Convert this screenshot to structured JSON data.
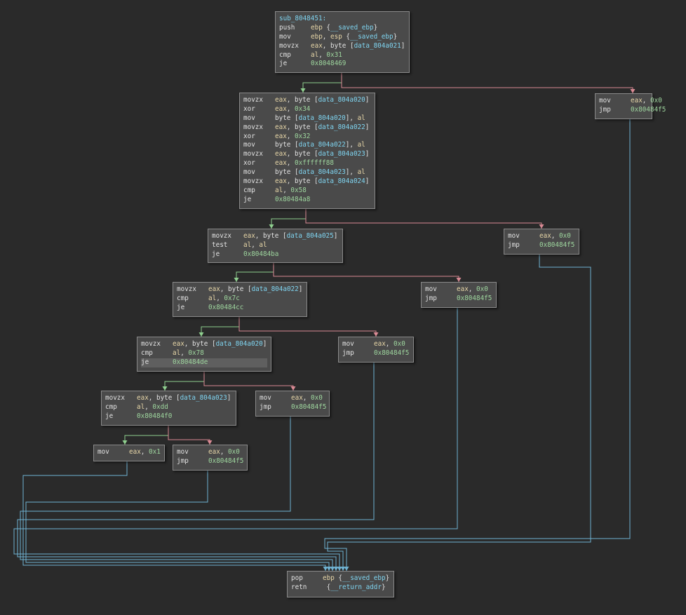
{
  "colors": {
    "background": "#2a2a2a",
    "block_fill": "#4a4a4a",
    "block_border": "#8a8a8a",
    "edge_true": "#8fcf8f",
    "edge_false": "#d98a94",
    "edge_jump": "#6fb2d2",
    "register": "#e8d7a8",
    "data_ref": "#7fd4f0",
    "number": "#9ed69e"
  },
  "blocks": {
    "entry": {
      "label": "sub_8048451:",
      "lines": [
        {
          "m": "push",
          "ops": [
            {
              "t": "reg",
              "v": "ebp"
            },
            {
              "t": "txt",
              "v": " {"
            },
            {
              "t": "dat",
              "v": "__saved_ebp"
            },
            {
              "t": "txt",
              "v": "}"
            }
          ]
        },
        {
          "m": "mov",
          "ops": [
            {
              "t": "reg",
              "v": "ebp"
            },
            {
              "t": "txt",
              "v": ", "
            },
            {
              "t": "reg",
              "v": "esp"
            },
            {
              "t": "txt",
              "v": " {"
            },
            {
              "t": "dat",
              "v": "__saved_ebp"
            },
            {
              "t": "txt",
              "v": "}"
            }
          ]
        },
        {
          "m": "movzx",
          "ops": [
            {
              "t": "reg",
              "v": "eax"
            },
            {
              "t": "txt",
              "v": ", byte ["
            },
            {
              "t": "dat",
              "v": "data_804a021"
            },
            {
              "t": "txt",
              "v": "]"
            }
          ]
        },
        {
          "m": "cmp",
          "ops": [
            {
              "t": "reg",
              "v": "al"
            },
            {
              "t": "txt",
              "v": ", "
            },
            {
              "t": "hex",
              "v": "0x31"
            }
          ]
        },
        {
          "m": "je",
          "ops": [
            {
              "t": "hex",
              "v": "0x8048469"
            }
          ]
        }
      ]
    },
    "b1": {
      "lines": [
        {
          "m": "movzx",
          "ops": [
            {
              "t": "reg",
              "v": "eax"
            },
            {
              "t": "txt",
              "v": ", byte ["
            },
            {
              "t": "dat",
              "v": "data_804a020"
            },
            {
              "t": "txt",
              "v": "]"
            }
          ]
        },
        {
          "m": "xor",
          "ops": [
            {
              "t": "reg",
              "v": "eax"
            },
            {
              "t": "txt",
              "v": ", "
            },
            {
              "t": "hex",
              "v": "0x34"
            }
          ]
        },
        {
          "m": "mov",
          "ops": [
            {
              "t": "txt",
              "v": "byte ["
            },
            {
              "t": "dat",
              "v": "data_804a020"
            },
            {
              "t": "txt",
              "v": "], "
            },
            {
              "t": "reg",
              "v": "al"
            }
          ]
        },
        {
          "m": "movzx",
          "ops": [
            {
              "t": "reg",
              "v": "eax"
            },
            {
              "t": "txt",
              "v": ", byte ["
            },
            {
              "t": "dat",
              "v": "data_804a022"
            },
            {
              "t": "txt",
              "v": "]"
            }
          ]
        },
        {
          "m": "xor",
          "ops": [
            {
              "t": "reg",
              "v": "eax"
            },
            {
              "t": "txt",
              "v": ", "
            },
            {
              "t": "hex",
              "v": "0x32"
            }
          ]
        },
        {
          "m": "mov",
          "ops": [
            {
              "t": "txt",
              "v": "byte ["
            },
            {
              "t": "dat",
              "v": "data_804a022"
            },
            {
              "t": "txt",
              "v": "], "
            },
            {
              "t": "reg",
              "v": "al"
            }
          ]
        },
        {
          "m": "movzx",
          "ops": [
            {
              "t": "reg",
              "v": "eax"
            },
            {
              "t": "txt",
              "v": ", byte ["
            },
            {
              "t": "dat",
              "v": "data_804a023"
            },
            {
              "t": "txt",
              "v": "]"
            }
          ]
        },
        {
          "m": "xor",
          "ops": [
            {
              "t": "reg",
              "v": "eax"
            },
            {
              "t": "txt",
              "v": ", "
            },
            {
              "t": "hex",
              "v": "0xffffff88"
            }
          ]
        },
        {
          "m": "mov",
          "ops": [
            {
              "t": "txt",
              "v": "byte ["
            },
            {
              "t": "dat",
              "v": "data_804a023"
            },
            {
              "t": "txt",
              "v": "], "
            },
            {
              "t": "reg",
              "v": "al"
            }
          ]
        },
        {
          "m": "movzx",
          "ops": [
            {
              "t": "reg",
              "v": "eax"
            },
            {
              "t": "txt",
              "v": ", byte ["
            },
            {
              "t": "dat",
              "v": "data_804a024"
            },
            {
              "t": "txt",
              "v": "]"
            }
          ]
        },
        {
          "m": "cmp",
          "ops": [
            {
              "t": "reg",
              "v": "al"
            },
            {
              "t": "txt",
              "v": ", "
            },
            {
              "t": "hex",
              "v": "0x58"
            }
          ]
        },
        {
          "m": "je",
          "ops": [
            {
              "t": "hex",
              "v": "0x80484a8"
            }
          ]
        }
      ]
    },
    "r0": {
      "lines": [
        {
          "m": "mov",
          "ops": [
            {
              "t": "reg",
              "v": "eax"
            },
            {
              "t": "txt",
              "v": ", "
            },
            {
              "t": "hex",
              "v": "0x0"
            }
          ]
        },
        {
          "m": "jmp",
          "ops": [
            {
              "t": "hex",
              "v": "0x80484f5"
            }
          ]
        }
      ]
    },
    "b2": {
      "lines": [
        {
          "m": "movzx",
          "ops": [
            {
              "t": "reg",
              "v": "eax"
            },
            {
              "t": "txt",
              "v": ", byte ["
            },
            {
              "t": "dat",
              "v": "data_804a025"
            },
            {
              "t": "txt",
              "v": "]"
            }
          ]
        },
        {
          "m": "test",
          "ops": [
            {
              "t": "reg",
              "v": "al"
            },
            {
              "t": "txt",
              "v": ", "
            },
            {
              "t": "reg",
              "v": "al"
            }
          ]
        },
        {
          "m": "je",
          "ops": [
            {
              "t": "hex",
              "v": "0x80484ba"
            }
          ]
        }
      ]
    },
    "r1": {
      "lines": [
        {
          "m": "mov",
          "ops": [
            {
              "t": "reg",
              "v": "eax"
            },
            {
              "t": "txt",
              "v": ", "
            },
            {
              "t": "hex",
              "v": "0x0"
            }
          ]
        },
        {
          "m": "jmp",
          "ops": [
            {
              "t": "hex",
              "v": "0x80484f5"
            }
          ]
        }
      ]
    },
    "b3": {
      "lines": [
        {
          "m": "movzx",
          "ops": [
            {
              "t": "reg",
              "v": "eax"
            },
            {
              "t": "txt",
              "v": ", byte ["
            },
            {
              "t": "dat",
              "v": "data_804a022"
            },
            {
              "t": "txt",
              "v": "]"
            }
          ]
        },
        {
          "m": "cmp",
          "ops": [
            {
              "t": "reg",
              "v": "al"
            },
            {
              "t": "txt",
              "v": ", "
            },
            {
              "t": "hex",
              "v": "0x7c"
            }
          ]
        },
        {
          "m": "je",
          "ops": [
            {
              "t": "hex",
              "v": "0x80484cc"
            }
          ]
        }
      ]
    },
    "r2": {
      "lines": [
        {
          "m": "mov",
          "ops": [
            {
              "t": "reg",
              "v": "eax"
            },
            {
              "t": "txt",
              "v": ", "
            },
            {
              "t": "hex",
              "v": "0x0"
            }
          ]
        },
        {
          "m": "jmp",
          "ops": [
            {
              "t": "hex",
              "v": "0x80484f5"
            }
          ]
        }
      ]
    },
    "b4": {
      "lines": [
        {
          "m": "movzx",
          "ops": [
            {
              "t": "reg",
              "v": "eax"
            },
            {
              "t": "txt",
              "v": ", byte ["
            },
            {
              "t": "dat",
              "v": "data_804a020"
            },
            {
              "t": "txt",
              "v": "]"
            }
          ]
        },
        {
          "m": "cmp",
          "ops": [
            {
              "t": "reg",
              "v": "al"
            },
            {
              "t": "txt",
              "v": ", "
            },
            {
              "t": "hex",
              "v": "0x78"
            }
          ]
        },
        {
          "m": "je",
          "hl": true,
          "ops": [
            {
              "t": "hex",
              "v": "0x80484de"
            }
          ]
        }
      ]
    },
    "r3": {
      "lines": [
        {
          "m": "mov",
          "ops": [
            {
              "t": "reg",
              "v": "eax"
            },
            {
              "t": "txt",
              "v": ", "
            },
            {
              "t": "hex",
              "v": "0x0"
            }
          ]
        },
        {
          "m": "jmp",
          "ops": [
            {
              "t": "hex",
              "v": "0x80484f5"
            }
          ]
        }
      ]
    },
    "b5": {
      "lines": [
        {
          "m": "movzx",
          "ops": [
            {
              "t": "reg",
              "v": "eax"
            },
            {
              "t": "txt",
              "v": ", byte ["
            },
            {
              "t": "dat",
              "v": "data_804a023"
            },
            {
              "t": "txt",
              "v": "]"
            }
          ]
        },
        {
          "m": "cmp",
          "ops": [
            {
              "t": "reg",
              "v": "al"
            },
            {
              "t": "txt",
              "v": ", "
            },
            {
              "t": "hex",
              "v": "0xdd"
            }
          ]
        },
        {
          "m": "je",
          "ops": [
            {
              "t": "hex",
              "v": "0x80484f0"
            }
          ]
        }
      ]
    },
    "r4": {
      "lines": [
        {
          "m": "mov",
          "ops": [
            {
              "t": "reg",
              "v": "eax"
            },
            {
              "t": "txt",
              "v": ", "
            },
            {
              "t": "hex",
              "v": "0x0"
            }
          ]
        },
        {
          "m": "jmp",
          "ops": [
            {
              "t": "hex",
              "v": "0x80484f5"
            }
          ]
        }
      ]
    },
    "ok": {
      "lines": [
        {
          "m": "mov",
          "ops": [
            {
              "t": "reg",
              "v": "eax"
            },
            {
              "t": "txt",
              "v": ", "
            },
            {
              "t": "hex",
              "v": "0x1"
            }
          ]
        }
      ]
    },
    "r5": {
      "lines": [
        {
          "m": "mov",
          "ops": [
            {
              "t": "reg",
              "v": "eax"
            },
            {
              "t": "txt",
              "v": ", "
            },
            {
              "t": "hex",
              "v": "0x0"
            }
          ]
        },
        {
          "m": "jmp",
          "ops": [
            {
              "t": "hex",
              "v": "0x80484f5"
            }
          ]
        }
      ]
    },
    "exit": {
      "lines": [
        {
          "m": "pop",
          "ops": [
            {
              "t": "reg",
              "v": "ebp"
            },
            {
              "t": "txt",
              "v": " {"
            },
            {
              "t": "dat",
              "v": "__saved_ebp"
            },
            {
              "t": "txt",
              "v": "}"
            }
          ]
        },
        {
          "m": "retn",
          "ops": [
            {
              "t": "txt",
              "v": " {"
            },
            {
              "t": "dat",
              "v": "__return_addr"
            },
            {
              "t": "txt",
              "v": "}"
            }
          ]
        }
      ]
    }
  },
  "edges": [
    {
      "from": "entry",
      "to": "b1",
      "kind": "true"
    },
    {
      "from": "entry",
      "to": "r0",
      "kind": "false"
    },
    {
      "from": "b1",
      "to": "b2",
      "kind": "true"
    },
    {
      "from": "b1",
      "to": "r1",
      "kind": "false"
    },
    {
      "from": "b2",
      "to": "b3",
      "kind": "true"
    },
    {
      "from": "b2",
      "to": "r2",
      "kind": "false"
    },
    {
      "from": "b3",
      "to": "b4",
      "kind": "true"
    },
    {
      "from": "b3",
      "to": "r3",
      "kind": "false"
    },
    {
      "from": "b4",
      "to": "b5",
      "kind": "true"
    },
    {
      "from": "b4",
      "to": "r4",
      "kind": "false"
    },
    {
      "from": "b5",
      "to": "ok",
      "kind": "true"
    },
    {
      "from": "b5",
      "to": "r5",
      "kind": "false"
    },
    {
      "from": "ok",
      "to": "exit",
      "kind": "jump"
    },
    {
      "from": "r5",
      "to": "exit",
      "kind": "jump"
    },
    {
      "from": "r4",
      "to": "exit",
      "kind": "jump"
    },
    {
      "from": "r3",
      "to": "exit",
      "kind": "jump"
    },
    {
      "from": "r2",
      "to": "exit",
      "kind": "jump"
    },
    {
      "from": "r1",
      "to": "exit",
      "kind": "jump"
    },
    {
      "from": "r0",
      "to": "exit",
      "kind": "jump"
    }
  ]
}
